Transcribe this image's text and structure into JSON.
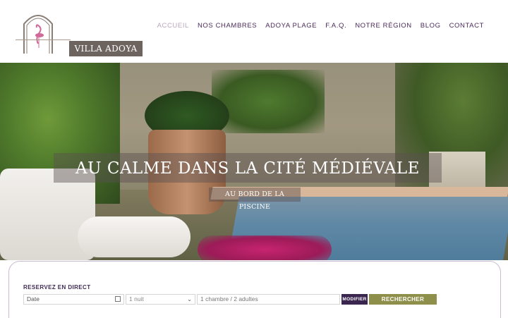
{
  "brand": {
    "name": "VILLA ADOYA",
    "logo_icon": "flamingo-arch-icon"
  },
  "nav": {
    "items": [
      {
        "label": "ACCUEIL",
        "active": true
      },
      {
        "label": "NOS CHAMBRES"
      },
      {
        "label": "ADOYA PLAGE"
      },
      {
        "label": "F.A.Q."
      },
      {
        "label": "NOTRE RÉGION"
      },
      {
        "label": "BLOG"
      },
      {
        "label": "CONTACT"
      }
    ]
  },
  "hero": {
    "title": "AU CALME DANS LA CITÉ MÉDIÉVALE",
    "subtitle": "AU BORD DE LA PISCINE"
  },
  "booking": {
    "title": "RESERVEZ EN DIRECT",
    "date_value": "Date",
    "date_icon": "calendar-icon",
    "nights_value": "1 nuit",
    "rooms_value": "1 chambre / 2 adultes",
    "modify_label": "MODIFIER",
    "search_label": "RECHERCHER"
  },
  "colors": {
    "brand_purple": "#4b2a5a",
    "active_nav": "#b7a8bd",
    "search_button": "#8d8f4a",
    "modify_button": "#3b2650"
  }
}
